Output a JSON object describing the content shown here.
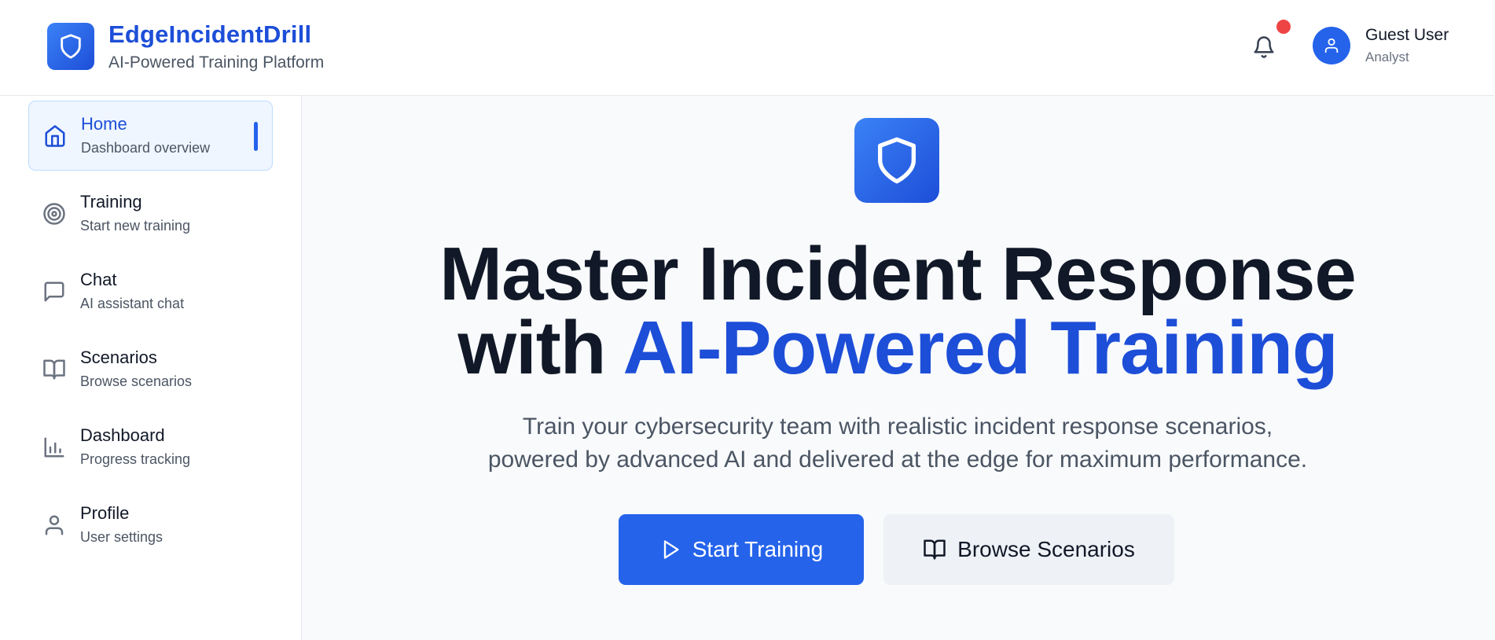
{
  "header": {
    "brand_title": "EdgeIncidentDrill",
    "brand_subtitle": "AI-Powered Training Platform",
    "logo_icon": "shield-icon",
    "notification_icon": "bell-icon",
    "has_unread_notification": true,
    "user": {
      "name": "Guest User",
      "role": "Analyst",
      "avatar_icon": "user-icon"
    }
  },
  "sidebar": {
    "items": [
      {
        "label": "Home",
        "description": "Dashboard overview",
        "icon": "home-icon",
        "active": true
      },
      {
        "label": "Training",
        "description": "Start new training",
        "icon": "target-icon",
        "active": false
      },
      {
        "label": "Chat",
        "description": "AI assistant chat",
        "icon": "chat-icon",
        "active": false
      },
      {
        "label": "Scenarios",
        "description": "Browse scenarios",
        "icon": "book-icon",
        "active": false
      },
      {
        "label": "Dashboard",
        "description": "Progress tracking",
        "icon": "bar-chart-icon",
        "active": false
      },
      {
        "label": "Profile",
        "description": "User settings",
        "icon": "user-icon",
        "active": false
      }
    ]
  },
  "hero": {
    "logo_icon": "shield-icon",
    "title_line1": "Master Incident Response",
    "title_line2_prefix": "with ",
    "title_line2_accent": "AI-Powered Training",
    "subtitle_line1": "Train your cybersecurity team with realistic incident response scenarios,",
    "subtitle_line2": "powered by advanced AI and delivered at the edge for maximum performance.",
    "primary_button": {
      "label": "Start Training",
      "icon": "play-icon"
    },
    "secondary_button": {
      "label": "Browse Scenarios",
      "icon": "book-icon"
    }
  },
  "colors": {
    "accent": "#2563eb",
    "accent_dark": "#1d4ed8",
    "notification_dot": "#ef4444",
    "active_nav_bg": "#eff6ff",
    "page_bg": "#f8fafc"
  }
}
